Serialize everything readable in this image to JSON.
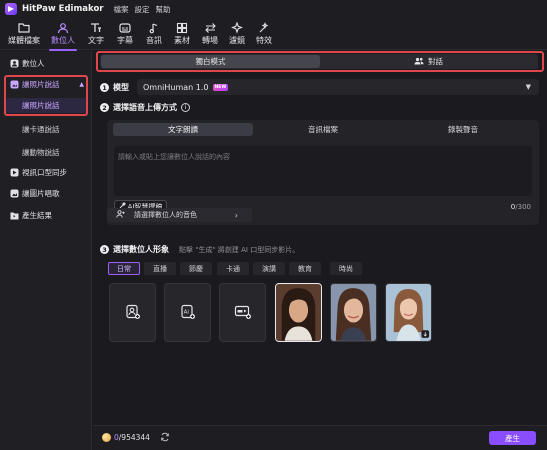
{
  "app": {
    "title": "HitPaw Edimakor",
    "menus": [
      "檔案",
      "設定",
      "幫助"
    ]
  },
  "toolbar": {
    "tools": [
      {
        "label": "媒體檔案",
        "icon": "folder-icon"
      },
      {
        "label": "數位人",
        "icon": "digital-human-icon"
      },
      {
        "label": "文字",
        "icon": "text-icon"
      },
      {
        "label": "字幕",
        "icon": "subtitle-icon"
      },
      {
        "label": "音訊",
        "icon": "music-note-icon"
      },
      {
        "label": "素材",
        "icon": "assets-icon"
      },
      {
        "label": "轉場",
        "icon": "transition-icon"
      },
      {
        "label": "濾鏡",
        "icon": "filter-icon"
      },
      {
        "label": "特效",
        "icon": "effects-icon"
      }
    ],
    "active_index": 1
  },
  "sidebar": {
    "digital_human": "數位人",
    "photo_talk": "讓照片說話",
    "photo_talk_sub": [
      "讓照片說話",
      "讓卡通說話",
      "讓動物說話"
    ],
    "video_lipsync": "視訊口型同步",
    "photo_sing": "讓圖片唱歌",
    "results": "產生結果"
  },
  "mode": {
    "tabs": [
      "獨白模式",
      "對話"
    ],
    "active_index": 0
  },
  "model": {
    "step_num": "1",
    "label": "模型",
    "value": "OmniHuman 1.0",
    "badge": "NEW"
  },
  "audio": {
    "step_num": "2",
    "label": "選擇語音上傳方式",
    "tabs": [
      "文字朗讀",
      "音訊檔案",
      "錄製聲音"
    ],
    "active_tab": 0,
    "placeholder": "請輸入或貼上您讓數位人說話的內容",
    "ai_button": "AI智慧撰稿",
    "count_current": "0",
    "count_max": "/300",
    "voice_button": "請選擇數位人的音色"
  },
  "avatar": {
    "step_num": "3",
    "label": "選擇數位人形象",
    "hint": "點擊 \"生成\" 將創建 AI 口型同步影片。",
    "categories": [
      "日常",
      "直播",
      "節慶",
      "卡通",
      "演講",
      "教育",
      "時尚"
    ],
    "active_category": 0
  },
  "footer": {
    "credits_used": "0",
    "credits_total": "/954344",
    "generate_button": "產生"
  },
  "colors": {
    "accent": "#8a4dff",
    "highlight_box": "#e0474c",
    "background": "#1b1b1f"
  }
}
